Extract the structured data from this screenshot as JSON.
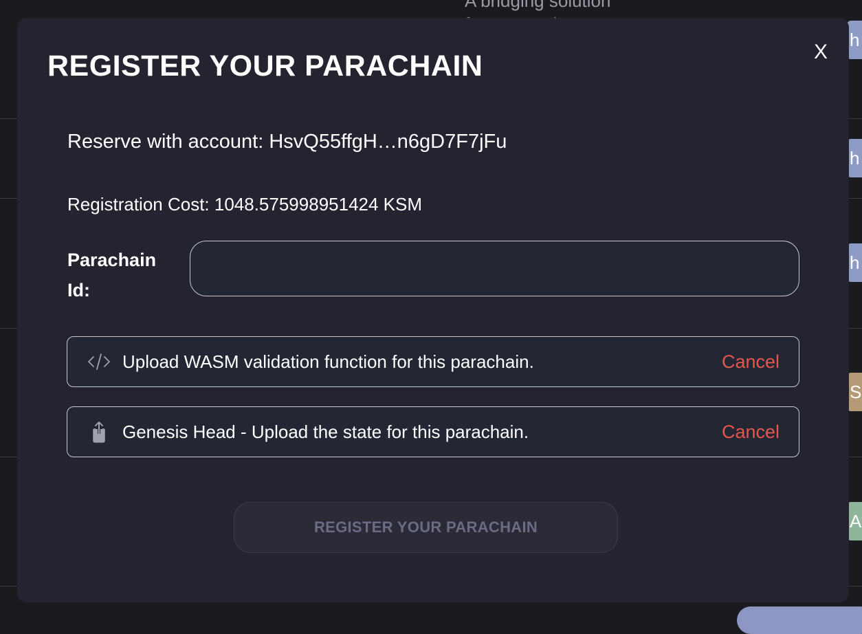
{
  "background": {
    "text_lines": [
      "A bridging solution",
      "for connecting"
    ],
    "chips": [
      {
        "label": "h",
        "color": "#8e9bc4"
      },
      {
        "label": "h",
        "color": "#8e9bc4"
      },
      {
        "label": "h",
        "color": "#8e9bc4"
      },
      {
        "label": "Sl",
        "color": "#b59a76"
      },
      {
        "label": "A",
        "color": "#8fb59b"
      }
    ]
  },
  "modal": {
    "title": "REGISTER YOUR PARACHAIN",
    "close_label": "X",
    "account_line": "Reserve with account: HsvQ55ffgH…n6gD7F7jFu",
    "cost_line": "Registration Cost: 1048.575998951424 KSM",
    "parachain_id": {
      "label": "Parachain Id:",
      "value": "",
      "placeholder": ""
    },
    "uploads": [
      {
        "icon": "code-icon",
        "text": "Upload WASM validation function for this parachain.",
        "cancel_label": "Cancel"
      },
      {
        "icon": "upload-share-icon",
        "text": "Genesis Head - Upload the state for this parachain.",
        "cancel_label": "Cancel"
      }
    ],
    "submit_label": "REGISTER YOUR PARACHAIN"
  },
  "colors": {
    "modal_bg": "#23242f",
    "cancel": "#e5574e",
    "disabled_text": "#6b6c83"
  }
}
